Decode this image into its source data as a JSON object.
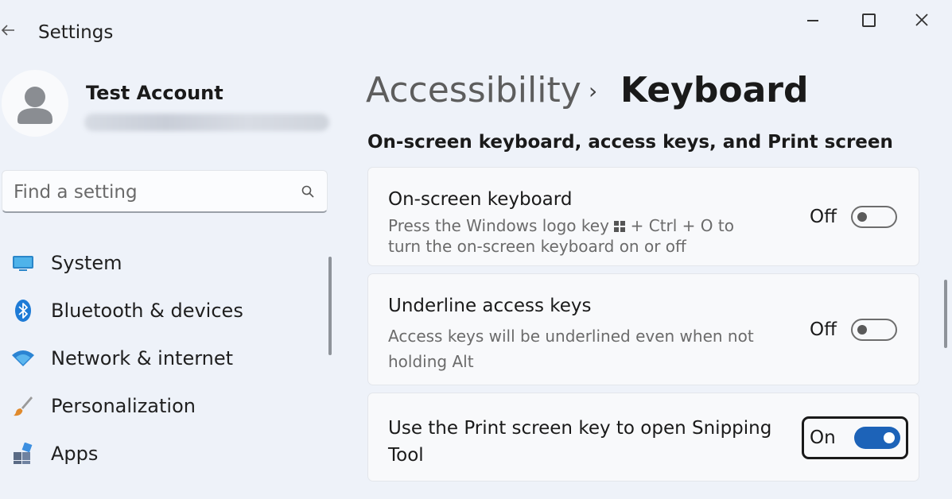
{
  "window": {
    "app_title": "Settings",
    "back_icon": "arrow-left-icon"
  },
  "profile": {
    "name": "Test Account"
  },
  "search": {
    "placeholder": "Find a setting",
    "value": ""
  },
  "sidebar": {
    "items": [
      {
        "label": "System",
        "icon": "monitor-icon"
      },
      {
        "label": "Bluetooth & devices",
        "icon": "bluetooth-icon"
      },
      {
        "label": "Network & internet",
        "icon": "wifi-icon"
      },
      {
        "label": "Personalization",
        "icon": "brush-icon"
      },
      {
        "label": "Apps",
        "icon": "apps-icon"
      }
    ]
  },
  "breadcrumb": {
    "parent": "Accessibility",
    "separator": "›",
    "current": "Keyboard"
  },
  "section": {
    "title": "On-screen keyboard, access keys, and Print screen"
  },
  "settings": [
    {
      "title": "On-screen keyboard",
      "desc_before": "Press the Windows logo key",
      "desc_after": "+ Ctrl + O to",
      "desc_line2": "turn the on-screen keyboard on or off",
      "state": "Off",
      "enabled": false
    },
    {
      "title": "Underline access keys",
      "desc_line1": "Access keys will be underlined even when not",
      "desc_line2": "holding Alt",
      "state": "Off",
      "enabled": false
    },
    {
      "title_line1": "Use the Print screen key to open Snipping",
      "title_line2": "Tool",
      "state": "On",
      "enabled": true
    }
  ],
  "colors": {
    "accent": "#1d63b8",
    "background": "#eef2f9",
    "card": "#f8f9fb"
  }
}
